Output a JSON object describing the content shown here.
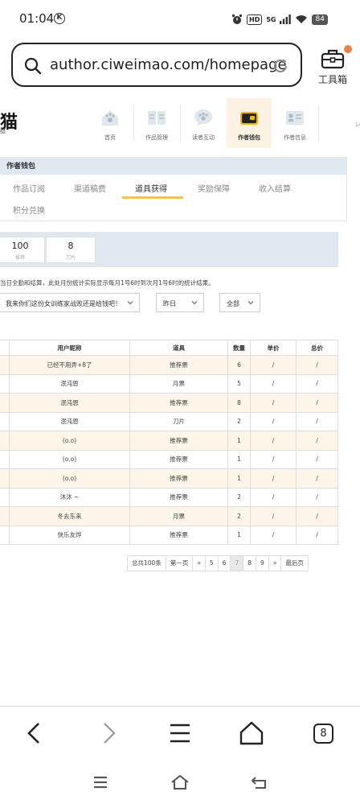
{
  "status_bar": {
    "time": "01:04",
    "k_badge": "K",
    "hd": "HD",
    "net": "5G",
    "battery": "84"
  },
  "browser": {
    "url": "author.ciweimao.com/homepage",
    "toolbox_label": "工具箱"
  },
  "site": {
    "logo": "猫",
    "logo_sub": "猎",
    "edge_text": "14",
    "nav": [
      {
        "label": "首页",
        "icon": "home-icon"
      },
      {
        "label": "作品管理",
        "icon": "book-icon"
      },
      {
        "label": "读者互动",
        "icon": "chat-icon"
      },
      {
        "label": "作者钱包",
        "icon": "wallet-icon"
      },
      {
        "label": "作者信息",
        "icon": "profile-card-icon"
      }
    ]
  },
  "wallet": {
    "title": "作者钱包",
    "tabs": [
      "作品订阅",
      "渠道稿费",
      "道具获得",
      "奖励保障",
      "收入结算",
      "积分兑换"
    ],
    "active_tab": "道具获得",
    "stats": [
      {
        "value": "100",
        "label": "推荐"
      },
      {
        "value": "8",
        "label": "刀片"
      }
    ],
    "notice": "当日全勤和结算，此处月份统计实际显示每月1号6时到次月1号6时的统计结果。",
    "filters": {
      "book": "我来你们这份女训练家战败还是给钱吧！",
      "date": "昨日",
      "type": "全部"
    }
  },
  "table": {
    "headers": [
      "",
      "用户昵称",
      "道具",
      "数量",
      "单价",
      "总价"
    ],
    "rows": [
      [
        "",
        "已经不用弄+8了",
        "推荐票",
        "6",
        "/",
        "/"
      ],
      [
        "",
        "泯沌恩",
        "月票",
        "5",
        "/",
        "/"
      ],
      [
        "",
        "泯沌恩",
        "推荐票",
        "8",
        "/",
        "/"
      ],
      [
        "",
        "泯沌恩",
        "刀片",
        "2",
        "/",
        "/"
      ],
      [
        "",
        "(o.o)",
        "推荐票",
        "1",
        "/",
        "/"
      ],
      [
        "",
        "(o.o)",
        "推荐票",
        "1",
        "/",
        "/"
      ],
      [
        "",
        "(o.o)",
        "推荐票",
        "1",
        "/",
        "/"
      ],
      [
        "",
        "沐沐 ~",
        "推荐票",
        "2",
        "/",
        "/"
      ],
      [
        "",
        "冬去东来",
        "月票",
        "2",
        "/",
        "/"
      ],
      [
        "",
        "快乐友烨",
        "推荐票",
        "1",
        "/",
        "/"
      ]
    ]
  },
  "pagination": {
    "total": "总共100条",
    "first": "第一页",
    "prev": "«",
    "pages": [
      "5",
      "6",
      "7",
      "8",
      "9"
    ],
    "current": "7",
    "next": "»",
    "last": "最后页"
  },
  "bottom_nav": {
    "tabs_count": "8"
  }
}
